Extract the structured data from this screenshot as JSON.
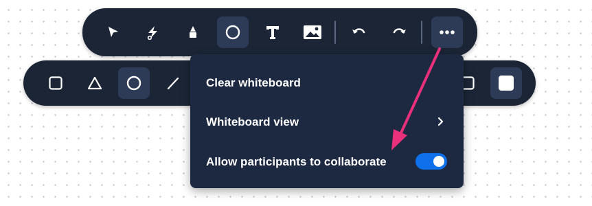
{
  "main_toolbar": {
    "tools": [
      {
        "icon": "select-arrow-icon",
        "active": false
      },
      {
        "icon": "laser-pointer-icon",
        "active": false
      },
      {
        "icon": "highlighter-icon",
        "active": false
      },
      {
        "icon": "circle-shape-icon",
        "active": true
      },
      {
        "icon": "text-tool-icon",
        "active": false
      },
      {
        "icon": "image-icon",
        "active": false
      },
      {
        "icon": "undo-icon",
        "active": false
      },
      {
        "icon": "redo-icon",
        "active": false
      },
      {
        "icon": "more-options-icon",
        "active": true
      }
    ]
  },
  "shapes_toolbar": {
    "tools": [
      {
        "icon": "square-shape-icon",
        "active": false
      },
      {
        "icon": "triangle-shape-icon",
        "active": false
      },
      {
        "icon": "circle-shape-icon",
        "active": true
      },
      {
        "icon": "line-shape-icon",
        "active": false
      },
      {
        "icon": "square-outline-icon",
        "active": false
      },
      {
        "icon": "square-filled-icon",
        "active": true
      }
    ]
  },
  "menu": {
    "items": [
      {
        "label": "Clear whiteboard"
      },
      {
        "label": "Whiteboard view",
        "has_submenu": true
      },
      {
        "label": "Allow participants to collaborate",
        "toggle_on": true
      }
    ]
  },
  "colors": {
    "toolbar_bg": "#1b2536",
    "menu_bg": "#1d2841",
    "toggle_on": "#0e71eb",
    "annotation_arrow": "#e8317a"
  }
}
